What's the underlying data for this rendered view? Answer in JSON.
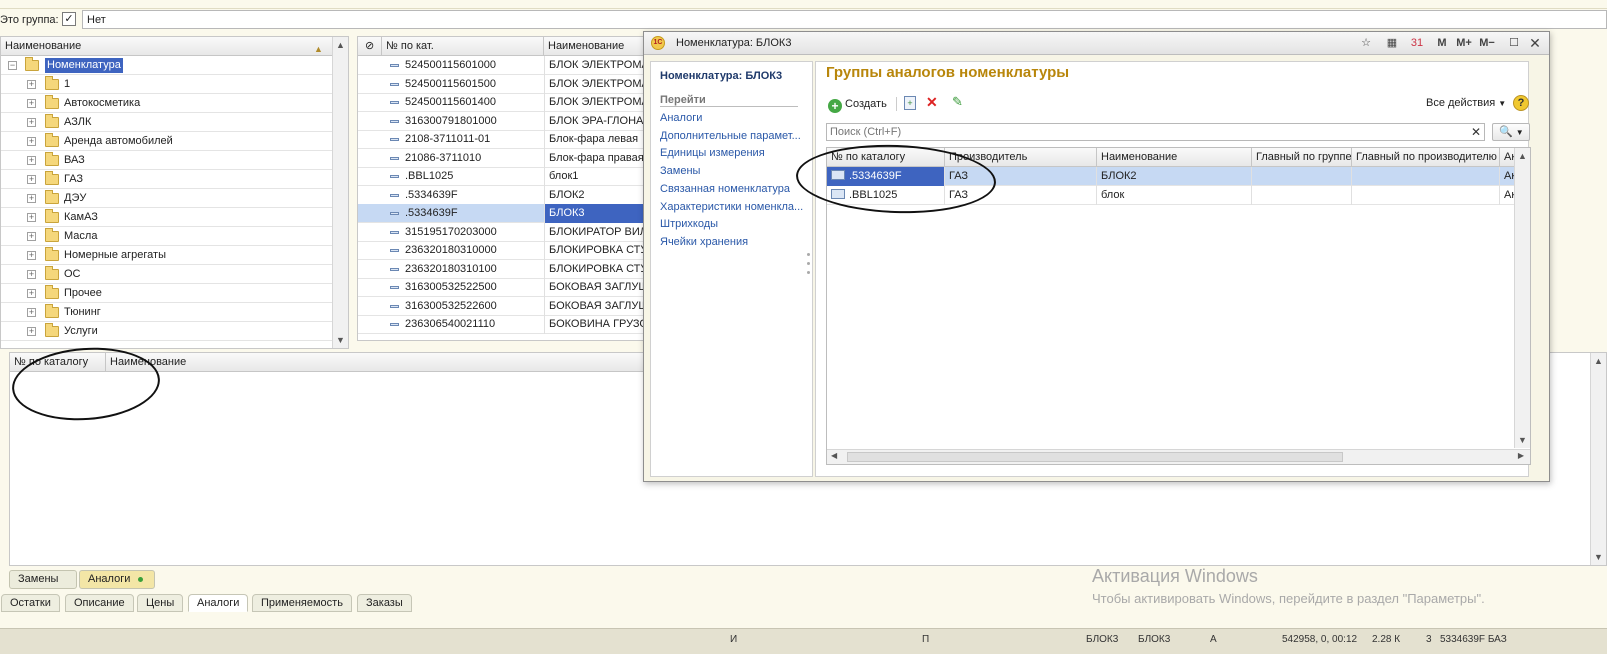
{
  "top": {
    "is_group_label": "Это группа:",
    "checkbox_mark": "✓",
    "value": "Нет"
  },
  "tree": {
    "header": "Наименование",
    "root": "Номенклатура",
    "items": [
      "1",
      "Автокосметика",
      "АЗЛК",
      "Аренда автомобилей",
      "ВАЗ",
      "ГАЗ",
      "ДЭУ",
      "КамАЗ",
      "Масла",
      "Номерные агрегаты",
      "ОС",
      "Прочее",
      "Тюнинг",
      "Услуги"
    ]
  },
  "catalog": {
    "col_num": "№ по кат.",
    "col_name": "Наименование",
    "rows": [
      {
        "num": "524500115601000",
        "name": "БЛОК ЭЛЕКТРОМА"
      },
      {
        "num": "524500115601500",
        "name": "БЛОК ЭЛЕКТРОМА"
      },
      {
        "num": "524500115601400",
        "name": "БЛОК ЭЛЕКТРОМА"
      },
      {
        "num": "316300791801000",
        "name": "БЛОК ЭРА-ГЛОНАС"
      },
      {
        "num": "2108-3711011-01",
        "name": "Блок-фара левая"
      },
      {
        "num": "21086-3711010",
        "name": "Блок-фара правая"
      },
      {
        "num": ".BBL1025",
        "name": "блок1"
      },
      {
        "num": ".5334639F",
        "name": "БЛОК2"
      },
      {
        "num": ".5334639F",
        "name": "БЛОК3"
      },
      {
        "num": "315195170203000",
        "name": "БЛОКИРАТОР ВИЛ"
      },
      {
        "num": "236320180310000",
        "name": "БЛОКИРОВКА СТУ"
      },
      {
        "num": "236320180310100",
        "name": "БЛОКИРОВКА СТУ"
      },
      {
        "num": "316300532522500",
        "name": "БОКОВАЯ ЗАГЛУШ"
      },
      {
        "num": "316300532522600",
        "name": "БОКОВАЯ ЗАГЛУШ"
      },
      {
        "num": "236306540021110",
        "name": "БОКОВИНА ГРУЗО"
      }
    ]
  },
  "bottom": {
    "col_num": "№ по каталогу",
    "col_name": "Наименование"
  },
  "subtabs": [
    "Замены",
    "Аналоги"
  ],
  "tabs": [
    "Остатки",
    "Описание",
    "Цены",
    "Аналоги",
    "Применяемость",
    "Заказы"
  ],
  "windows_activation": {
    "title": "Активация Windows",
    "subtitle": "Чтобы активировать Windows, перейдите в раздел \"Параметры\"."
  },
  "statusbar": [
    "И",
    "П",
    "БЛОК3",
    "БЛОК3",
    "А",
    "542958, 0, 00:12",
    "2.28 К",
    "3",
    "5334639F БАЗ"
  ],
  "dialog": {
    "title": "Номенклатура: БЛОК3",
    "left_title": "Номенклатура: БЛОК3",
    "goto": "Перейти",
    "nav": [
      "Аналоги",
      "Дополнительные парамет...",
      "Единицы измерения",
      "Замены",
      "Связанная номенклатура",
      "Характеристики номенкла...",
      "Штрихкоды",
      "Ячейки хранения"
    ],
    "heading": "Группы аналогов номенклатуры",
    "create": "Создать",
    "all_actions": "Все действия",
    "search_placeholder": "Поиск (Ctrl+F)",
    "toolbar_icons": {
      "m": "M",
      "mplus": "M+",
      "mminus": "M−",
      "cal31": "31"
    },
    "columns": [
      "№ по каталогу",
      "Производитель",
      "Наименование",
      "Главный по группе",
      "Главный по производителю",
      "Ак"
    ],
    "rows": [
      {
        "num": ".5334639F",
        "maker": "ГАЗ",
        "name": "БЛОК2",
        "main_group": "",
        "main_maker": "",
        "extra": "Ак"
      },
      {
        "num": ".BBL1025",
        "maker": "ГАЗ",
        "name": "блок",
        "main_group": "",
        "main_maker": "",
        "extra": "Ак"
      }
    ]
  }
}
